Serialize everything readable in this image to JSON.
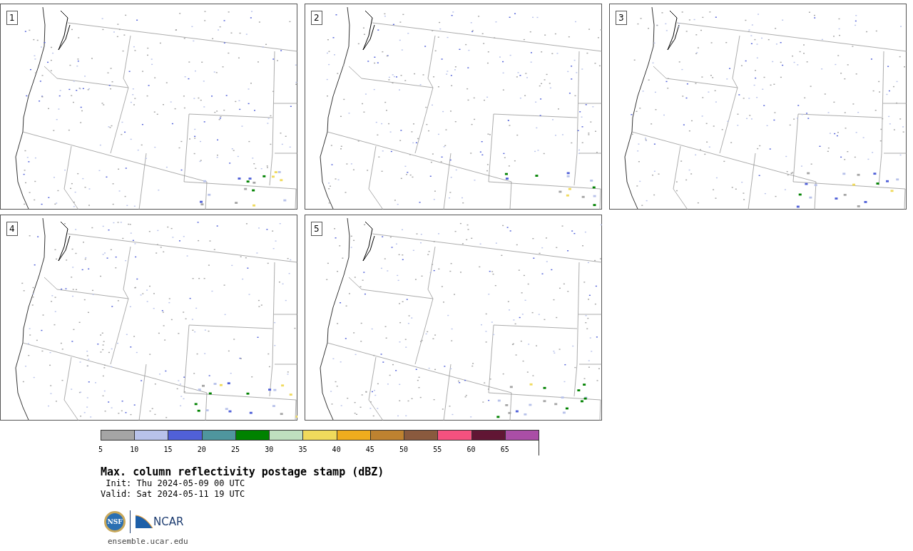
{
  "panels": [
    {
      "label": "1"
    },
    {
      "label": "2"
    },
    {
      "label": "3"
    },
    {
      "label": "4"
    },
    {
      "label": "5"
    }
  ],
  "colorbar": {
    "segments": [
      {
        "color": "#a5a5a5",
        "tick": "5"
      },
      {
        "color": "#b8c2ea",
        "tick": "10"
      },
      {
        "color": "#5060d8",
        "tick": "15"
      },
      {
        "color": "#4f969e",
        "tick": "20"
      },
      {
        "color": "#008200",
        "tick": "25"
      },
      {
        "color": "#bfdfbf",
        "tick": "30"
      },
      {
        "color": "#f0da5c",
        "tick": "35"
      },
      {
        "color": "#efac1d",
        "tick": "40"
      },
      {
        "color": "#be8230",
        "tick": "45"
      },
      {
        "color": "#8a5a3e",
        "tick": "50"
      },
      {
        "color": "#f4517f",
        "tick": "55"
      },
      {
        "color": "#611634",
        "tick": "60"
      },
      {
        "color": "#aa4ea6",
        "tick": "65"
      }
    ]
  },
  "title": "Max. column reflectivity postage stamp (dBZ)",
  "init": "Init: Thu 2024-05-09 00 UTC",
  "valid": "Valid: Sat 2024-05-11 19 UTC",
  "logos": {
    "nsf": "NSF",
    "ncar": "NCAR"
  },
  "footer": "ensemble.ucar.edu"
}
